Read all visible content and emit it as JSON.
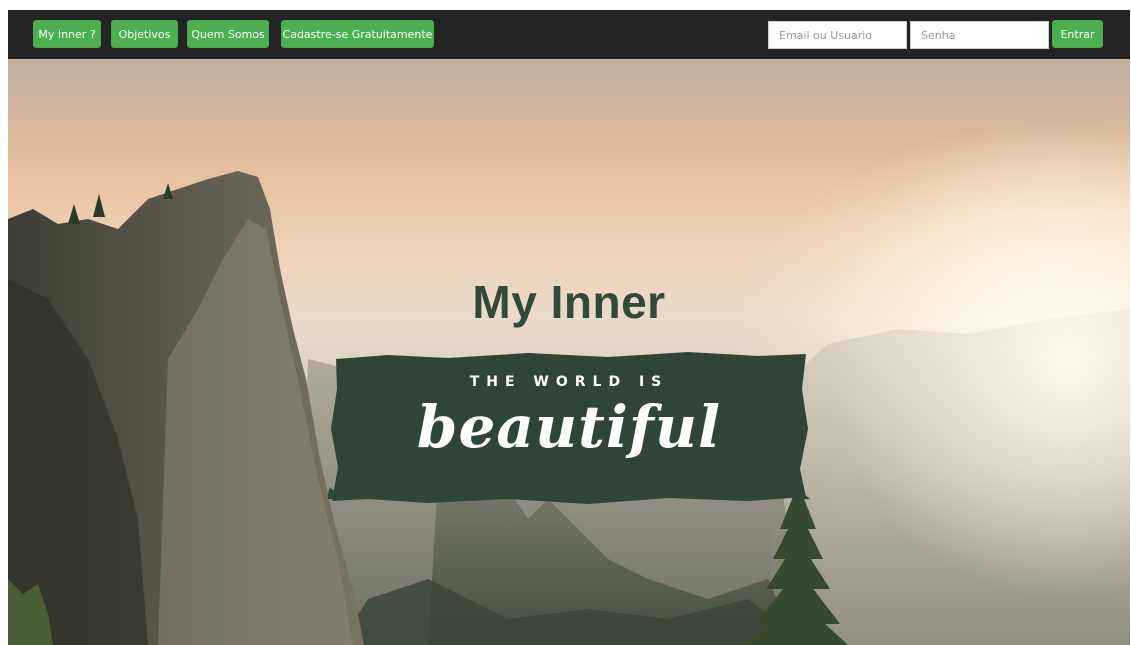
{
  "nav": {
    "links": [
      {
        "label": "My Inner ?"
      },
      {
        "label": "Objetivos"
      },
      {
        "label": "Quem Somos"
      },
      {
        "label": "Cadastre-se Gratuitamente"
      }
    ],
    "login": {
      "email_placeholder": "Email ou Usuario",
      "password_placeholder": "Senha",
      "submit_label": "Entrar"
    }
  },
  "hero": {
    "title": "My Inner",
    "banner_top": "THE WORLD IS",
    "banner_script": "beautiful"
  },
  "colors": {
    "nav_background": "#232323",
    "button_green": "#4caf50",
    "title_green": "#324a39",
    "banner_green": "#2f4537"
  }
}
